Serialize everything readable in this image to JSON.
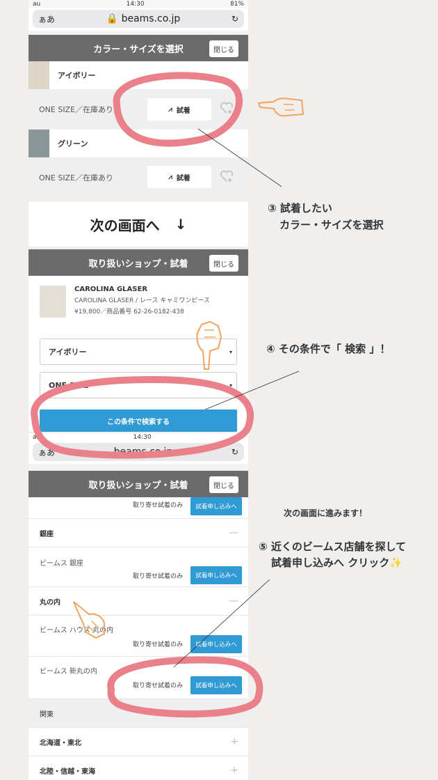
{
  "screen1": {
    "status": {
      "carrier": "au",
      "time": "14:30",
      "battery": "81%"
    },
    "url": {
      "aa": "ぁあ",
      "domain": "beams.co.jp"
    },
    "header_title": "カラー・サイズを選択",
    "close_label": "閉じる",
    "items": [
      {
        "color": "アイボリー",
        "size": "ONE SIZE／在庫あり",
        "try_label": "試着"
      },
      {
        "color": "グリーン",
        "size": "ONE SIZE／在庫あり",
        "try_label": "試着"
      }
    ]
  },
  "next_screen_text": "次の画面へ",
  "next_arrow": "↓",
  "screen2": {
    "header_title": "取り扱いショップ・試着",
    "close_label": "閉じる",
    "product": {
      "brand": "CAROLINA GLASER",
      "name": "CAROLINA GLASER / レース キャミワンピース",
      "price": "¥19,800／商品番号 62-26-0182-438"
    },
    "color_select": "アイボリー",
    "size_select": "ONE SIZE",
    "search_label": "この条件で検索する"
  },
  "screen3": {
    "status": {
      "carrier": "au",
      "time": "14:30"
    },
    "url": {
      "aa": "ぁあ",
      "domain": "beams.co.jp"
    },
    "header_title": "取り扱いショップ・試着",
    "close_label": "閉じる",
    "order_only": "取り寄せ試着のみ",
    "apply_label": "試着申し込みへ",
    "sections": [
      {
        "pref": "銀座",
        "shops": [
          "ビームス 銀座"
        ]
      },
      {
        "pref": "丸の内",
        "shops": [
          "ビームス ハウス 丸の内",
          "ビームス 新丸の内"
        ]
      }
    ],
    "regions": [
      "関東",
      "北海道・東北",
      "北陸・信越・東海"
    ]
  },
  "annotations": {
    "step3_line1": "③ 試着したい",
    "step3_line2": "カラー・サイズを選択",
    "step4": "④ その条件で「 検索 」！",
    "next_note": "次の画面に進みます！",
    "step5_line1": "⑤ 近くのビームス店舗を探して",
    "step5_line2": "試着申し込みへ クリック✨"
  },
  "colors": {
    "accent_blue": "#2f9ad3",
    "highlight_pink": "#e9808a",
    "hand_orange": "#f5a25c",
    "header_gray": "#6b6b6b"
  }
}
